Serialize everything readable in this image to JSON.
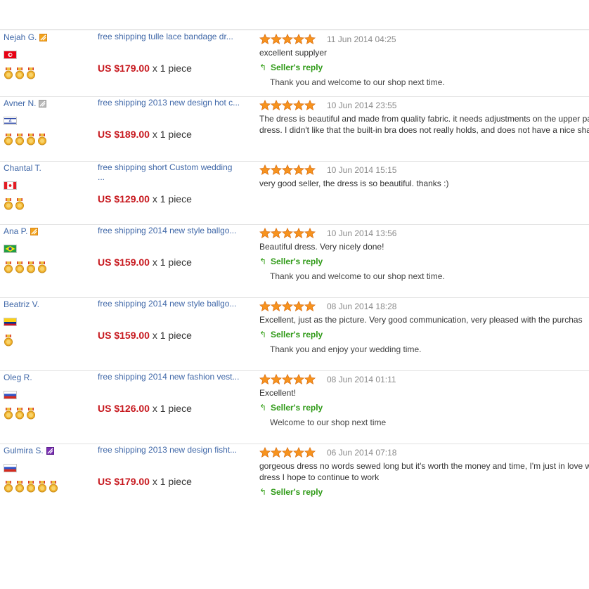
{
  "reviews": [
    {
      "buyer": "Nejah G.",
      "badge": "orange",
      "country": "tunisia",
      "medals": 3,
      "product_title": "free shipping tulle lace bandage dr...",
      "product_title_2": "",
      "price": "US $179.00",
      "quantity": "x 1 piece",
      "stars": 5,
      "date": "11 Jun 2014 04:25",
      "review_text": "excellent supplyer",
      "seller_reply_label": "Seller's reply",
      "seller_reply_text": "Thank you and welcome to our shop next time."
    },
    {
      "buyer": "Avner N.",
      "badge": "gray",
      "country": "israel",
      "medals": 4,
      "product_title": "free shipping 2013 new design hot c...",
      "product_title_2": "",
      "price": "US $189.00",
      "quantity": "x 1 piece",
      "stars": 5,
      "date": "10 Jun 2014 23:55",
      "review_text": "The dress is beautiful and made from quality fabric. it needs adjustments on the upper part of the dress. I didn't like that the built-in bra does not really holds, and does not have a nice shape.",
      "seller_reply_label": "",
      "seller_reply_text": ""
    },
    {
      "buyer": "Chantal T.",
      "badge": "",
      "country": "canada",
      "medals": 2,
      "product_title": "free shipping short Custom wedding",
      "product_title_2": "...",
      "price": "US $129.00",
      "quantity": "x 1 piece",
      "stars": 5,
      "date": "10 Jun 2014 15:15",
      "review_text": "very good seller, the dress is so beautiful. thanks :)",
      "seller_reply_label": "",
      "seller_reply_text": ""
    },
    {
      "buyer": "Ana P.",
      "badge": "orange",
      "country": "brazil",
      "medals": 4,
      "product_title": "free shipping 2014 new style ballgo...",
      "product_title_2": "",
      "price": "US $159.00",
      "quantity": "x 1 piece",
      "stars": 5,
      "date": "10 Jun 2014 13:56",
      "review_text": "Beautiful dress. Very nicely done!",
      "seller_reply_label": "Seller's reply",
      "seller_reply_text": "Thank you and welcome to our shop next time."
    },
    {
      "buyer": "Beatriz V.",
      "badge": "",
      "country": "colombia",
      "medals": 1,
      "product_title": "free shipping 2014 new style ballgo...",
      "product_title_2": "",
      "price": "US $159.00",
      "quantity": "x 1 piece",
      "stars": 5,
      "date": "08 Jun 2014 18:28",
      "review_text": "Excellent, just as the picture. Very good communication, very pleased with the purchas",
      "seller_reply_label": "Seller's reply",
      "seller_reply_text": "Thank you and enjoy your wedding time."
    },
    {
      "buyer": "Oleg R.",
      "badge": "",
      "country": "russia",
      "medals": 3,
      "product_title": "free shipping 2014 new fashion vest...",
      "product_title_2": "",
      "price": "US $126.00",
      "quantity": "x 1 piece",
      "stars": 5,
      "date": "08 Jun 2014 01:11",
      "review_text": "Excellent!",
      "seller_reply_label": "Seller's reply",
      "seller_reply_text": "Welcome to our shop next time"
    },
    {
      "buyer": "Gulmira S.",
      "badge": "purple",
      "country": "russia",
      "medals": 5,
      "product_title": "free shipping 2013 new design fisht...",
      "product_title_2": "",
      "price": "US $179.00",
      "quantity": "x 1 piece",
      "stars": 5,
      "date": "06 Jun 2014 07:18",
      "review_text": "gorgeous dress no words sewed long but it's worth the money and time, I'm just in love with this dress I hope to continue to work",
      "seller_reply_label": "Seller's reply",
      "seller_reply_text": ""
    }
  ],
  "colors": {
    "link": "#4068a8",
    "price": "#c7181e",
    "reply_label": "#2f9a17",
    "date": "#8a8a8a",
    "star": "#f7931e"
  }
}
